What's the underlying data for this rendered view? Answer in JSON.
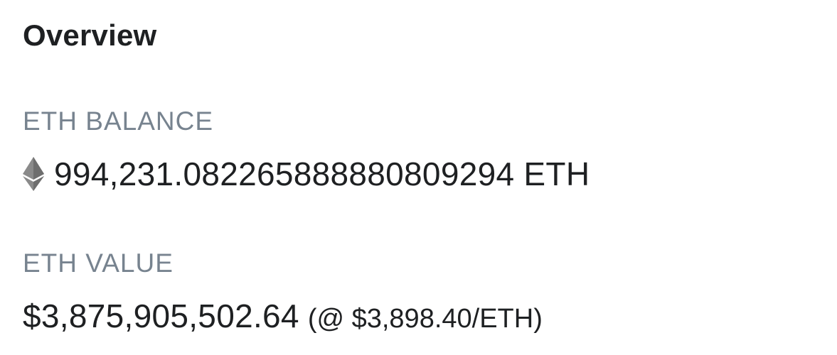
{
  "overview": {
    "title": "Overview",
    "balance_label": "ETH BALANCE",
    "balance_amount": "994,231.082265888880809294 ETH",
    "balance_icon": "ethereum-icon",
    "value_label": "ETH VALUE",
    "value_amount": "$3,875,905,502.64",
    "value_rate": "(@ $3,898.40/ETH)"
  },
  "colors": {
    "text_primary": "#1e2022",
    "text_muted": "#77838f",
    "icon": "#757575"
  }
}
